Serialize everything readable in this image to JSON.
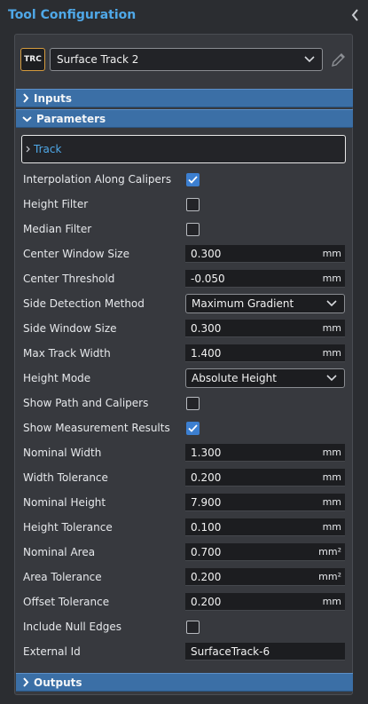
{
  "header": {
    "title": "Tool Configuration"
  },
  "tool": {
    "badge": "TRC",
    "selected_name": "Surface Track 2"
  },
  "sections": {
    "inputs": "Inputs",
    "parameters": "Parameters",
    "outputs": "Outputs"
  },
  "track": {
    "label": "Track"
  },
  "params": {
    "interpolation": {
      "label": "Interpolation Along Calipers",
      "checked": true
    },
    "height_filter": {
      "label": "Height Filter",
      "checked": false
    },
    "median_filter": {
      "label": "Median Filter",
      "checked": false
    },
    "center_window_size": {
      "label": "Center Window Size",
      "value": "0.300",
      "unit": "mm"
    },
    "center_threshold": {
      "label": "Center Threshold",
      "value": "-0.050",
      "unit": "mm"
    },
    "side_detection_method": {
      "label": "Side Detection Method",
      "value": "Maximum Gradient"
    },
    "side_window_size": {
      "label": "Side Window Size",
      "value": "0.300",
      "unit": "mm"
    },
    "max_track_width": {
      "label": "Max Track Width",
      "value": "1.400",
      "unit": "mm"
    },
    "height_mode": {
      "label": "Height Mode",
      "value": "Absolute Height"
    },
    "show_path_calipers": {
      "label": "Show Path and Calipers",
      "checked": false
    },
    "show_measurement_results": {
      "label": "Show Measurement Results",
      "checked": true
    },
    "nominal_width": {
      "label": "Nominal Width",
      "value": "1.300",
      "unit": "mm"
    },
    "width_tolerance": {
      "label": "Width Tolerance",
      "value": "0.200",
      "unit": "mm"
    },
    "nominal_height": {
      "label": "Nominal Height",
      "value": "7.900",
      "unit": "mm"
    },
    "height_tolerance": {
      "label": "Height Tolerance",
      "value": "0.100",
      "unit": "mm"
    },
    "nominal_area": {
      "label": "Nominal Area",
      "value": "0.700",
      "unit": "mm²"
    },
    "area_tolerance": {
      "label": "Area Tolerance",
      "value": "0.200",
      "unit": "mm²"
    },
    "offset_tolerance": {
      "label": "Offset Tolerance",
      "value": "0.200",
      "unit": "mm"
    },
    "include_null_edges": {
      "label": "Include Null Edges",
      "checked": false
    },
    "external_id": {
      "label": "External Id",
      "value": "SurfaceTrack-6"
    }
  },
  "colors": {
    "accent": "#4fa8e8",
    "section_header": "#3b6fa6",
    "checkbox_checked": "#3c7fd0",
    "badge_border": "#d59b3e"
  },
  "icons": [
    "chevron-left-icon",
    "chevron-down-icon",
    "chevron-right-icon",
    "pencil-icon",
    "checkmark-icon"
  ]
}
